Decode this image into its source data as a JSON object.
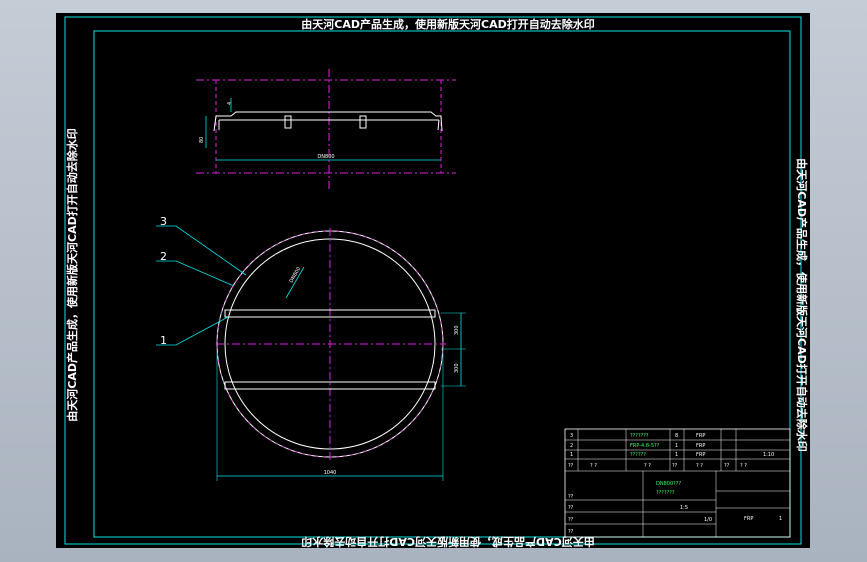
{
  "watermark": {
    "top": "由天河CAD产品生成，使用新版天河CAD打开自动去除水印",
    "left": "由天河CAD产品生成，使用新版天河CAD打开自动去除水印",
    "right": "由天河CAD产品生成，使用新版天河CAD打开自动去除水印",
    "bottom": "由天河CAD产品生成，使用新版天河CAD打开自动去除水印"
  },
  "section_view": {
    "dim_height": "80",
    "dim_width": "DN800",
    "dim_small": "4"
  },
  "plan_view": {
    "leaders": [
      "3",
      "2",
      "1"
    ],
    "dim_diameter": "DN800",
    "dim_gap_1": "300",
    "dim_gap_2": "300",
    "dim_outer": "1040"
  },
  "title_block": {
    "parts": [
      {
        "no": "3",
        "name": "???????",
        "qty": "8",
        "material": "FRP"
      },
      {
        "no": "2",
        "name": "FRP-4.8-5??",
        "qty": "1",
        "material": "FRP"
      },
      {
        "no": "1",
        "name": "?????? ",
        "qty": "1",
        "material": "FRP"
      }
    ],
    "header_row": [
      "??",
      "? ?",
      "? ?",
      "??",
      "? ?",
      "??",
      "? ?"
    ],
    "scale_label": "1:10",
    "scale_ratio": "1:5",
    "drawing_name": "DN800???",
    "drawing_sub": "???????",
    "material": "FRP",
    "sheet": "1",
    "count_label": "1/0",
    "sign_rows": [
      "??",
      "??",
      "??",
      "??"
    ]
  },
  "colors": {
    "frame": "#00e5e5",
    "centerline": "#e020e0",
    "part": "#ffffff",
    "dimension": "#00e5e5",
    "title_green": "#33ff66"
  }
}
